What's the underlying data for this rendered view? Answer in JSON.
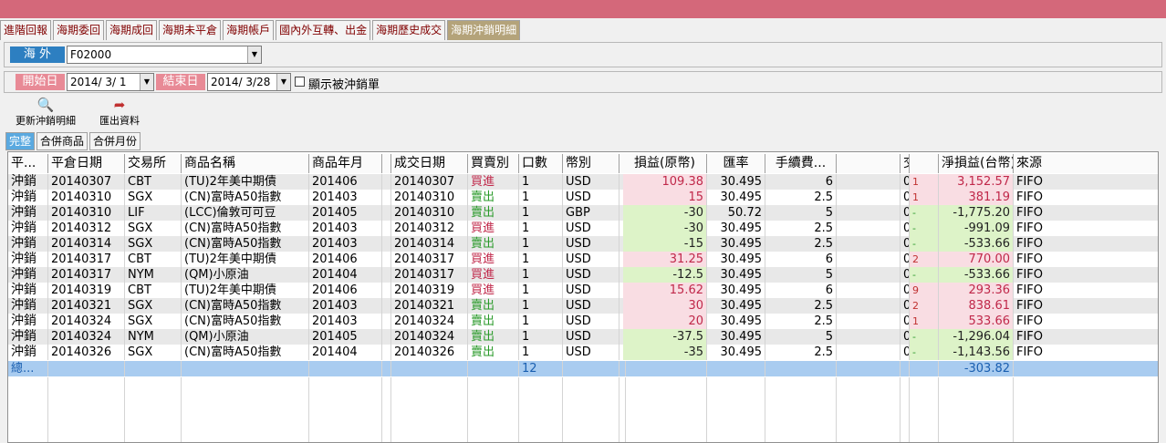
{
  "tabs": [
    "進階回報",
    "海期委回",
    "海期成回",
    "海期未平倉",
    "海期帳戶",
    "國內外互轉、出金",
    "海期歷史成交",
    "海期沖銷明細"
  ],
  "market_label": "海 外",
  "account_value": "F02000",
  "start_label": "開始日",
  "start_date": "2014/  3/  1",
  "end_label": "結束日",
  "end_date": "2014/  3/28",
  "show_offset_label": "顯示被沖銷單",
  "toolbar": {
    "refresh_label": "更新沖銷明細",
    "export_label": "匯出資料"
  },
  "subtabs": [
    "完整",
    "合併商品",
    "合併月份"
  ],
  "columns": [
    "平...",
    "平倉日期",
    "交易所",
    "商品名稱",
    "商品年月",
    "",
    "成交日期",
    "買賣別",
    "口數",
    "幣別",
    "",
    "損益(原幣)",
    "匯率",
    "手續費...",
    "",
    "交易稅",
    "",
    "淨損益(台幣)",
    "來源"
  ],
  "rows": [
    [
      "沖銷",
      "20140307",
      "CBT",
      "(TU)2年美中期債",
      "201406",
      "20140307",
      "買進",
      "1",
      "USD",
      "109.38",
      "30.495",
      "6",
      "0",
      "1",
      "3,152.57",
      "FIFO"
    ],
    [
      "沖銷",
      "20140310",
      "SGX",
      "(CN)富時A50指數",
      "201403",
      "20140310",
      "賣出",
      "1",
      "USD",
      "15",
      "30.495",
      "2.5",
      "0",
      "1",
      "381.19",
      "FIFO"
    ],
    [
      "沖銷",
      "20140310",
      "LIF",
      "(LCC)倫敦可可豆",
      "201405",
      "20140310",
      "賣出",
      "1",
      "GBP",
      "-30",
      "50.72",
      "5",
      "0",
      "-",
      "-1,775.20",
      "FIFO"
    ],
    [
      "沖銷",
      "20140312",
      "SGX",
      "(CN)富時A50指數",
      "201403",
      "20140312",
      "買進",
      "1",
      "USD",
      "-30",
      "30.495",
      "2.5",
      "0",
      "-",
      "-991.09",
      "FIFO"
    ],
    [
      "沖銷",
      "20140314",
      "SGX",
      "(CN)富時A50指數",
      "201403",
      "20140314",
      "賣出",
      "1",
      "USD",
      "-15",
      "30.495",
      "2.5",
      "0",
      "-",
      "-533.66",
      "FIFO"
    ],
    [
      "沖銷",
      "20140317",
      "CBT",
      "(TU)2年美中期債",
      "201406",
      "20140317",
      "買進",
      "1",
      "USD",
      "31.25",
      "30.495",
      "6",
      "0",
      "2",
      "770.00",
      "FIFO"
    ],
    [
      "沖銷",
      "20140317",
      "NYM",
      "(QM)小原油",
      "201404",
      "20140317",
      "買進",
      "1",
      "USD",
      "-12.5",
      "30.495",
      "5",
      "0",
      "-",
      "-533.66",
      "FIFO"
    ],
    [
      "沖銷",
      "20140319",
      "CBT",
      "(TU)2年美中期債",
      "201406",
      "20140319",
      "買進",
      "1",
      "USD",
      "15.62",
      "30.495",
      "6",
      "0",
      "9",
      "293.36",
      "FIFO"
    ],
    [
      "沖銷",
      "20140321",
      "SGX",
      "(CN)富時A50指數",
      "201403",
      "20140321",
      "賣出",
      "1",
      "USD",
      "30",
      "30.495",
      "2.5",
      "0",
      "2",
      "838.61",
      "FIFO"
    ],
    [
      "沖銷",
      "20140324",
      "SGX",
      "(CN)富時A50指數",
      "201403",
      "20140324",
      "賣出",
      "1",
      "USD",
      "20",
      "30.495",
      "2.5",
      "0",
      "1",
      "533.66",
      "FIFO"
    ],
    [
      "沖銷",
      "20140324",
      "NYM",
      "(QM)小原油",
      "201405",
      "20140324",
      "賣出",
      "1",
      "USD",
      "-37.5",
      "30.495",
      "5",
      "0",
      "-",
      "-1,296.04",
      "FIFO"
    ],
    [
      "沖銷",
      "20140326",
      "SGX",
      "(CN)富時A50指數",
      "201404",
      "20140326",
      "賣出",
      "1",
      "USD",
      "-35",
      "30.495",
      "2.5",
      "0",
      "-",
      "-1,143.56",
      "FIFO"
    ]
  ],
  "total": {
    "label": "總...",
    "qty": "12",
    "net": "-303.82"
  },
  "colors": {
    "title": "#d4687a",
    "active_tab": "#b4a37a",
    "buy": "#c0284a",
    "sell": "#2a9a2a",
    "pos_bg": "#f9dde3",
    "neg_bg": "#ddf3c8",
    "total_bg": "#a9ccf0",
    "row_alt": "#e8e8e8"
  }
}
